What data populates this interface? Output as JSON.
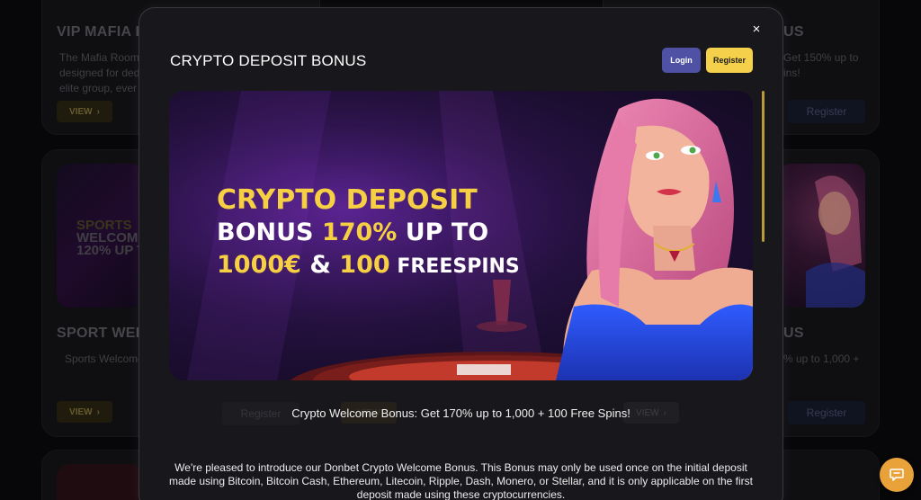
{
  "background": {
    "cards": {
      "vip": {
        "title": "VIP MAFIA I",
        "text": "The Mafia Room designed for ded elite group, ever",
        "view_label": "VIEW",
        "view_arrow": "›"
      },
      "right_top": {
        "title": "US",
        "text": "Get 150% up to ins!",
        "register_label": "Register"
      },
      "sport": {
        "title": "SPORT WEL",
        "text": "Sports Welcome",
        "view_label": "VIEW",
        "view_arrow": "›",
        "thumb_text": [
          "SPORTS",
          "WELCOME",
          "120% UP T"
        ]
      },
      "right_mid": {
        "title": "US",
        "text": "% up to 1,000 +",
        "register_label": "Register"
      }
    },
    "ghost_register_label": "Register",
    "ghost_view_label": "VIEW",
    "ghost_view_arrow": "›"
  },
  "modal": {
    "close_icon": "×",
    "title": "CRYPTO DEPOSIT BONUS",
    "login_label": "Login",
    "register_label": "Register",
    "banner": {
      "line1": "CRYPTO DEPOSIT",
      "line2_a": "BONUS ",
      "line2_b": "170%",
      "line2_c": " UP TO",
      "line3_a": "1000€",
      "line3_b": " & ",
      "line3_c": "100",
      "line3_d": " FREESPINS"
    },
    "subtitle": "Crypto Welcome Bonus: Get 170% up to 1,000 + 100 Free Spins!",
    "body": "We're pleased to introduce our Donbet Crypto Welcome Bonus. This Bonus may only be used once on the initial deposit made using Bitcoin, Bitcoin Cash, Ethereum, Litecoin, Ripple, Dash, Monero, or Stellar, and it is only applicable on the first deposit made using these cryptocurrencies."
  },
  "colors": {
    "accent_yellow": "#f6cf43",
    "login_blue": "#4f52a4",
    "chat_orange": "#e9a23a"
  },
  "chat_icon": "chat-bubble-icon"
}
